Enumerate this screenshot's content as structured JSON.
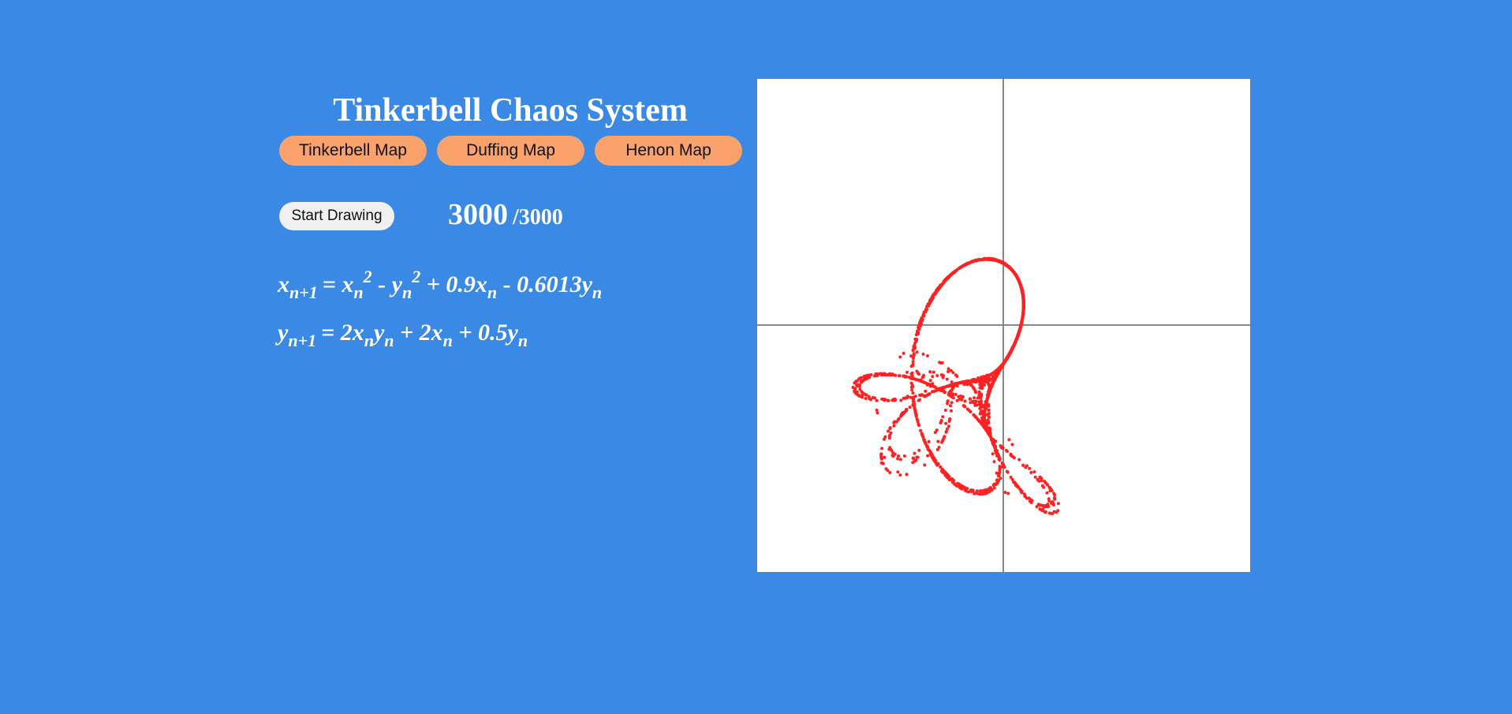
{
  "title": "Tinkerbell Chaos System",
  "map_buttons": [
    {
      "label": "Tinkerbell Map"
    },
    {
      "label": "Duffing Map"
    },
    {
      "label": "Henon Map"
    }
  ],
  "controls": {
    "start_label": "Start Drawing",
    "count": "3000",
    "total": "/3000"
  },
  "equations": {
    "x": {
      "lhs": "x",
      "lhs_sub": "n+1",
      "t1": "x",
      "t1_sub": "n",
      "t1_sup": "2",
      "t2": "y",
      "t2_sub": "n",
      "t2_sup": "2",
      "t3": "0.9x",
      "t3_sub": "n",
      "t4": "0.6013y",
      "t4_sub": "n"
    },
    "y": {
      "lhs": "y",
      "lhs_sub": "n+1",
      "t1a": "2x",
      "t1a_sub": "n",
      "t1b": "y",
      "t1b_sub": "n",
      "t2": "2x",
      "t2_sub": "n",
      "t3": "0.5y",
      "t3_sub": "n"
    }
  },
  "plot": {
    "point_color": "#ff2222",
    "axis_color": "#888888",
    "background": "#ffffff",
    "parameters": {
      "a": 0.9,
      "b": -0.6013,
      "c": 2.0,
      "d": 0.5
    },
    "iterations": 3000
  }
}
